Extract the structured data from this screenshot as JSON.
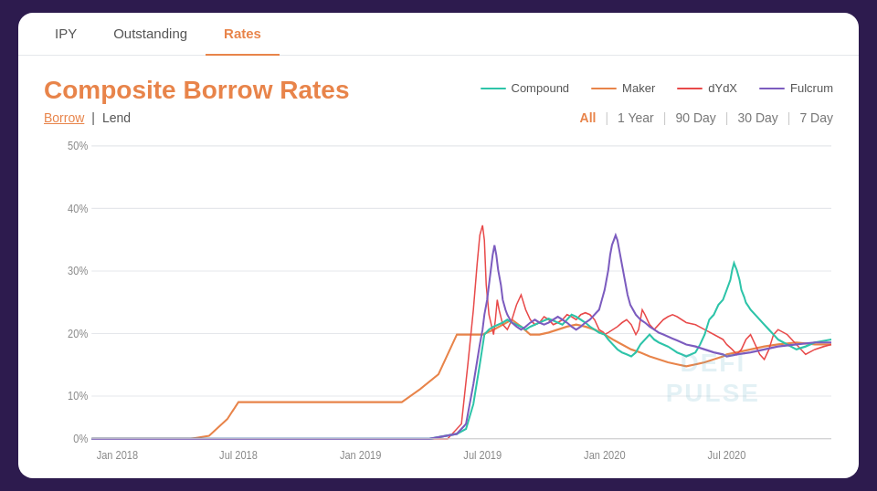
{
  "tabs": [
    {
      "id": "ipy",
      "label": "IPY",
      "active": false
    },
    {
      "id": "outstanding",
      "label": "Outstanding",
      "active": false
    },
    {
      "id": "rates",
      "label": "Rates",
      "active": true
    }
  ],
  "title": "Composite Borrow Rates",
  "legend": [
    {
      "name": "Compound",
      "color": "#2ec4a9"
    },
    {
      "name": "Maker",
      "color": "#e8844a"
    },
    {
      "name": "dYdX",
      "color": "#e84a4a"
    },
    {
      "name": "Fulcrum",
      "color": "#7c5cbf"
    }
  ],
  "borrow_label": "Borrow",
  "lend_label": "Lend",
  "time_filters": [
    {
      "label": "All",
      "active": true
    },
    {
      "label": "1 Year",
      "active": false
    },
    {
      "label": "90 Day",
      "active": false
    },
    {
      "label": "30 Day",
      "active": false
    },
    {
      "label": "7 Day",
      "active": false
    }
  ],
  "y_axis_labels": [
    "50%",
    "40%",
    "30%",
    "20%",
    "10%",
    "0%"
  ],
  "x_axis_labels": [
    "Jan 2018",
    "Jul 2018",
    "Jan 2019",
    "Jul 2019",
    "Jan 2020",
    "Jul 2020"
  ],
  "watermark_line1": "DEFI",
  "watermark_line2": "PULSE"
}
